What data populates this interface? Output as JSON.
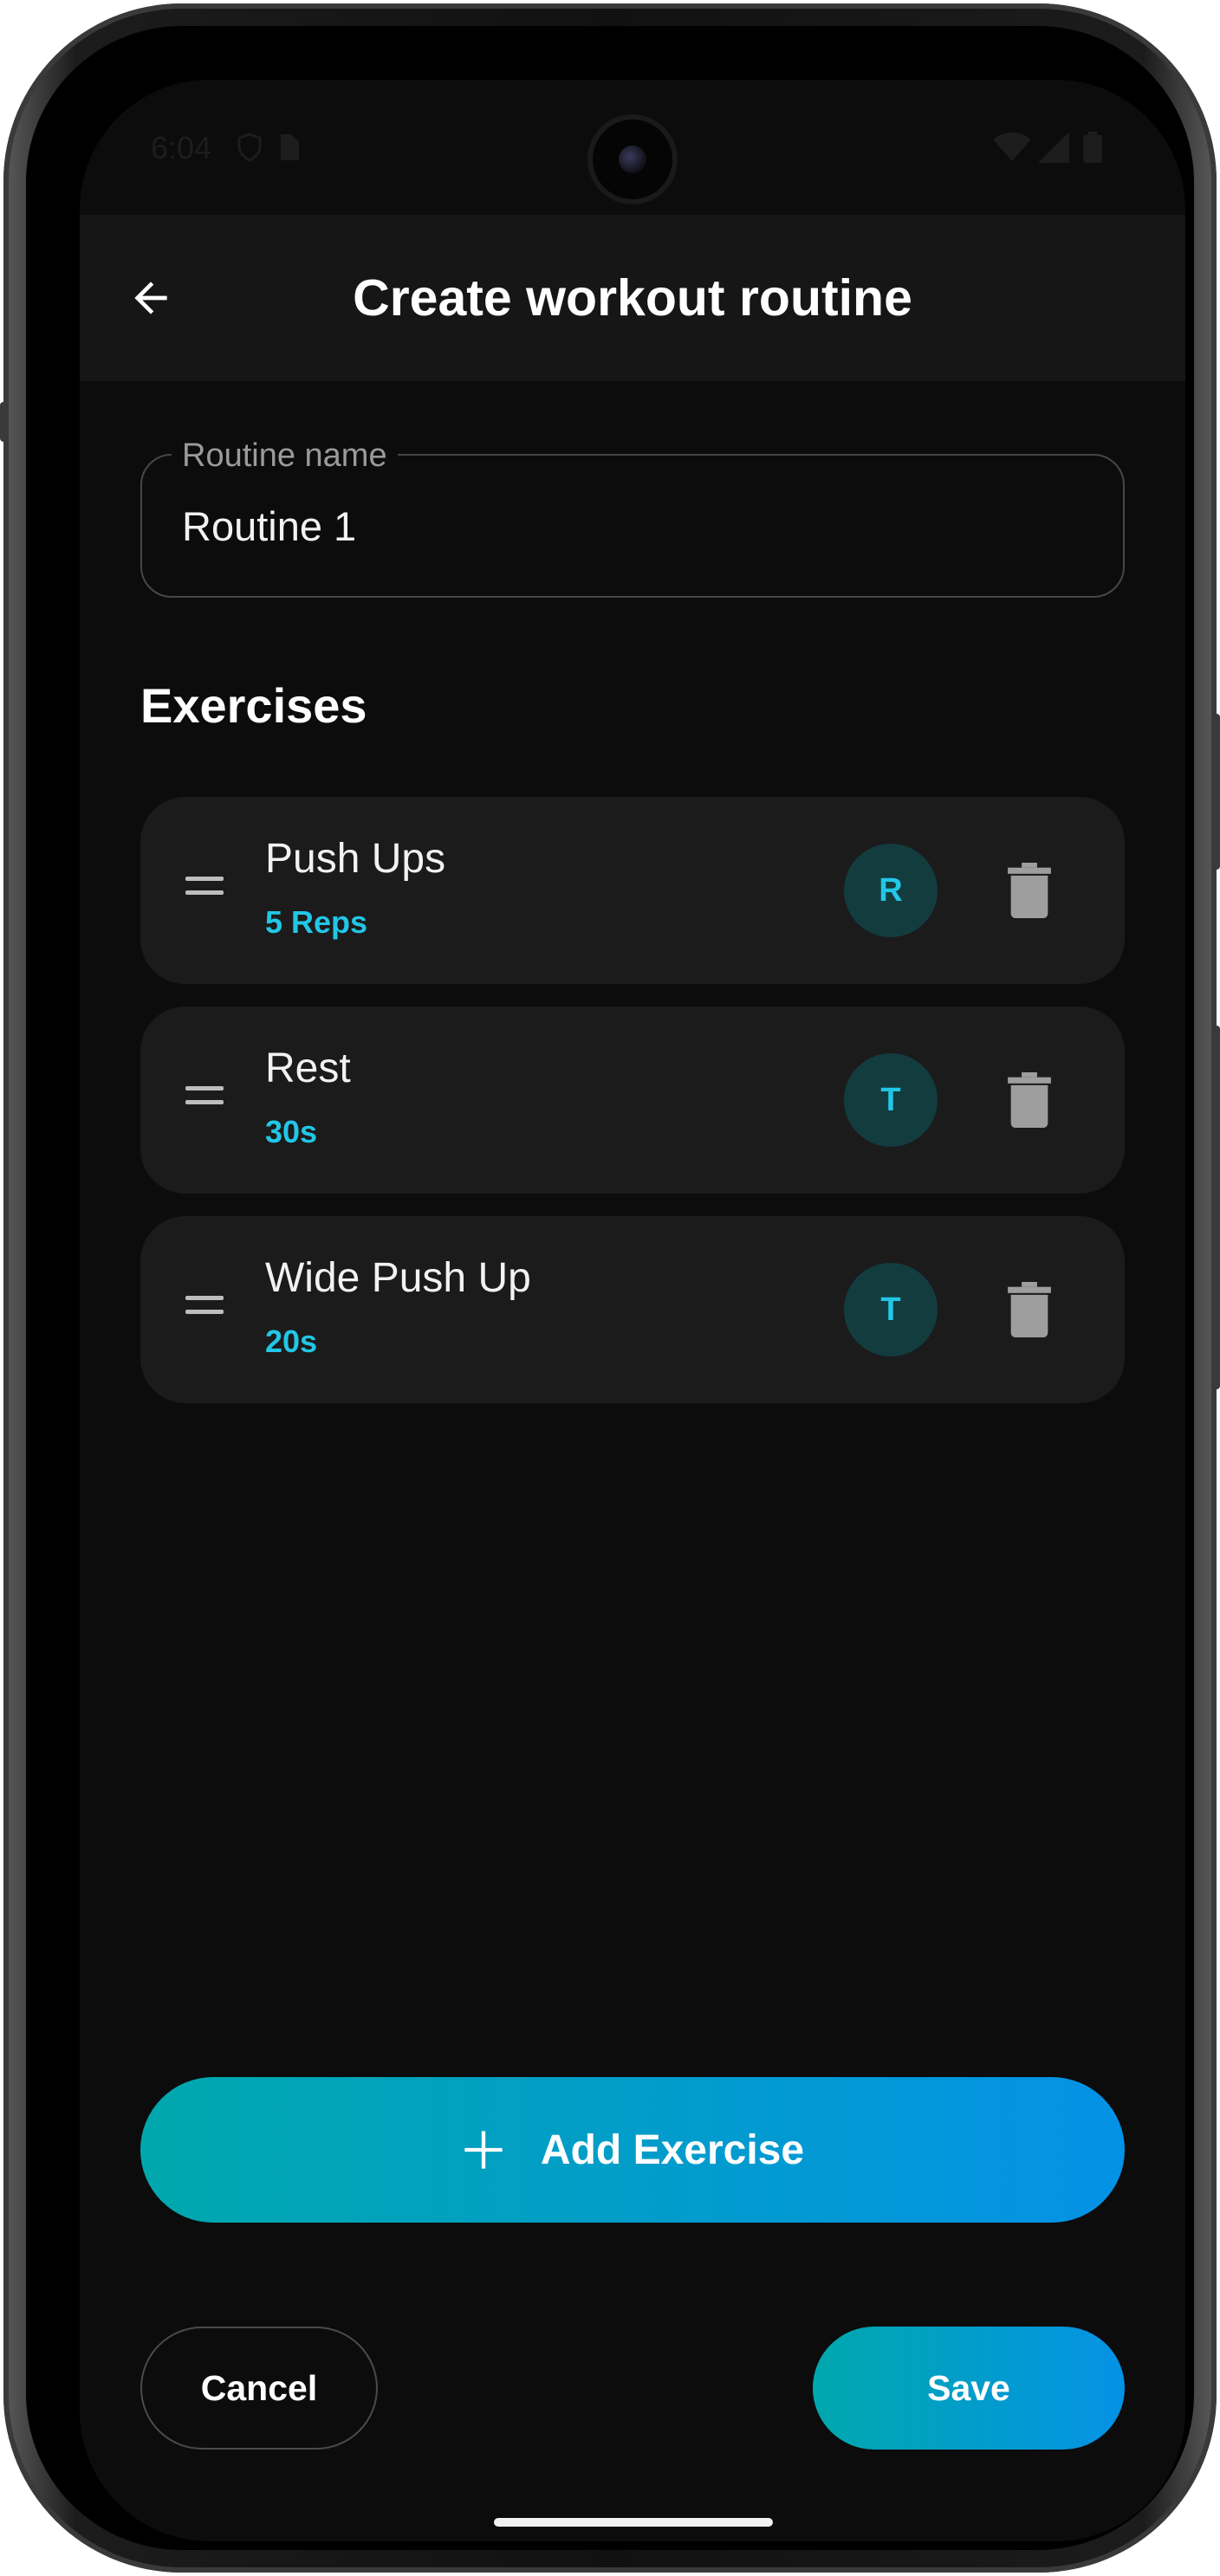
{
  "status_bar": {
    "time": "6:04"
  },
  "app_bar": {
    "title": "Create workout routine"
  },
  "routine_name": {
    "label": "Routine name",
    "value": "Routine 1"
  },
  "exercises_section": {
    "title": "Exercises"
  },
  "exercises": [
    {
      "name": "Push Ups",
      "detail": "5 Reps",
      "type_badge": "R"
    },
    {
      "name": "Rest",
      "detail": "30s",
      "type_badge": "T"
    },
    {
      "name": "Wide Push Up",
      "detail": "20s",
      "type_badge": "T"
    }
  ],
  "actions": {
    "add_exercise_label": "Add Exercise",
    "cancel_label": "Cancel",
    "save_label": "Save"
  },
  "icons": {
    "back": "arrow-left-icon",
    "drag": "drag-handle-icon",
    "delete": "trash-icon",
    "add": "plus-icon"
  },
  "colors": {
    "background": "#0c0c0c",
    "app_bar": "#161616",
    "card": "#1b1b1b",
    "accent": "#22c6e6",
    "badge_bg": "#133c3f",
    "gradient_start": "#00a8ad",
    "gradient_end": "#0492e6"
  }
}
